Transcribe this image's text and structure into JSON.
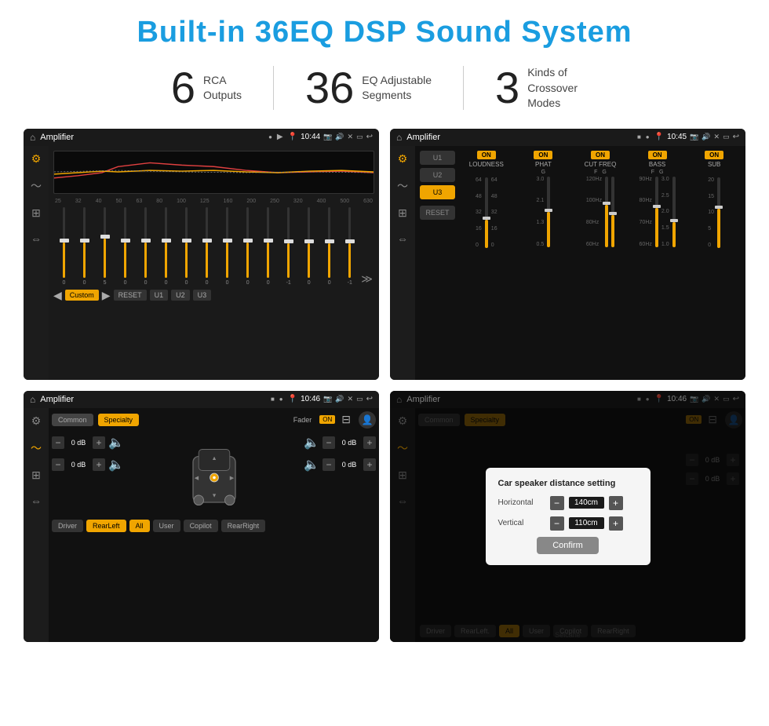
{
  "page": {
    "title": "Built-in 36EQ DSP Sound System",
    "background_color": "#ffffff"
  },
  "stats": [
    {
      "number": "6",
      "label": "RCA\nOutputs"
    },
    {
      "number": "36",
      "label": "EQ Adjustable\nSegments"
    },
    {
      "number": "3",
      "label": "Kinds of\nCrossover Modes"
    }
  ],
  "screenshots": [
    {
      "id": "eq-screen",
      "title": "Amplifier",
      "time": "10:44",
      "type": "equalizer",
      "bottom_buttons": [
        "Custom",
        "RESET",
        "U1",
        "U2",
        "U3"
      ],
      "freq_labels": [
        "25",
        "32",
        "40",
        "50",
        "63",
        "80",
        "100",
        "125",
        "160",
        "200",
        "250",
        "320",
        "400",
        "500",
        "630"
      ],
      "sliders": [
        50,
        50,
        55,
        50,
        50,
        50,
        50,
        50,
        50,
        50,
        50,
        49,
        49,
        49,
        49
      ]
    },
    {
      "id": "crossover-screen",
      "title": "Amplifier",
      "time": "10:45",
      "type": "crossover",
      "presets": [
        "U1",
        "U2",
        "U3"
      ],
      "channels": [
        "LOUDNESS",
        "PHAT",
        "CUT FREQ",
        "BASS",
        "SUB"
      ],
      "reset_label": "RESET"
    },
    {
      "id": "fader-screen",
      "title": "Amplifier",
      "time": "10:46",
      "type": "fader",
      "tabs": [
        "Common",
        "Specialty"
      ],
      "fader_label": "Fader",
      "toggle": "ON",
      "channels": [
        {
          "label": "0 dB"
        },
        {
          "label": "0 dB"
        },
        {
          "label": "0 dB"
        },
        {
          "label": "0 dB"
        }
      ],
      "bottom_buttons": [
        "Driver",
        "RearLeft",
        "All",
        "User",
        "Copilot",
        "RearRight"
      ]
    },
    {
      "id": "dialog-screen",
      "title": "Amplifier",
      "time": "10:46",
      "type": "dialog",
      "tabs": [
        "Common",
        "Specialty"
      ],
      "toggle": "ON",
      "dialog": {
        "title": "Car speaker distance setting",
        "horizontal_label": "Horizontal",
        "horizontal_value": "140cm",
        "vertical_label": "Vertical",
        "vertical_value": "110cm",
        "confirm_label": "Confirm"
      },
      "channels_right": [
        {
          "label": "0 dB"
        },
        {
          "label": "0 dB"
        }
      ],
      "bottom_buttons": [
        "Driver",
        "RearLeft",
        "All",
        "User",
        "Copilot",
        "RearRight"
      ],
      "watermark": "Seicane"
    }
  ]
}
